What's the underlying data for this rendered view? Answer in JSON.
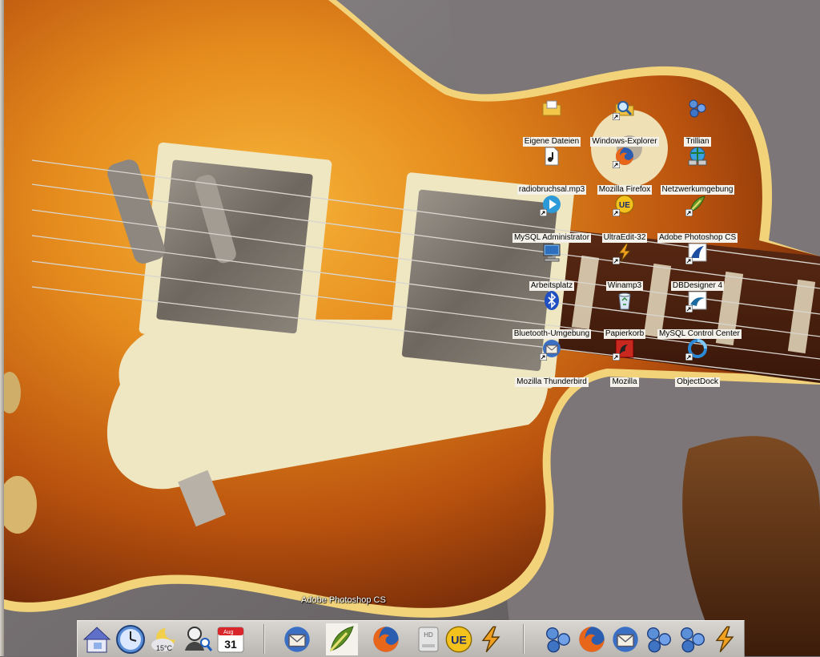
{
  "desktop": {
    "icons": [
      {
        "label": "Eigene Dateien",
        "icon": "folder-docs-icon"
      },
      {
        "label": "Windows-Explorer",
        "icon": "explorer-icon"
      },
      {
        "label": "Trillian",
        "icon": "trillian-icon"
      },
      {
        "label": "radiobruchsal.mp3",
        "icon": "mp3-file-icon"
      },
      {
        "label": "Mozilla Firefox",
        "icon": "firefox-icon"
      },
      {
        "label": "Netzwerkumgebung",
        "icon": "network-icon"
      },
      {
        "label": "MySQL Administrator",
        "icon": "mysql-admin-icon"
      },
      {
        "label": "UltraEdit-32",
        "icon": "ultraedit-icon"
      },
      {
        "label": "Adobe Photoshop CS",
        "icon": "photoshop-icon"
      },
      {
        "label": "Arbeitsplatz",
        "icon": "computer-icon"
      },
      {
        "label": "Winamp3",
        "icon": "winamp-icon"
      },
      {
        "label": "DBDesigner 4",
        "icon": "dbdesigner-icon"
      },
      {
        "label": "Bluetooth-Umgebung",
        "icon": "bluetooth-icon"
      },
      {
        "label": "Papierkorb",
        "icon": "recycle-bin-icon"
      },
      {
        "label": "MySQL Control Center",
        "icon": "mysql-cc-icon"
      },
      {
        "label": "Mozilla Thunderbird",
        "icon": "thunderbird-icon"
      },
      {
        "label": "Mozilla",
        "icon": "mozilla-icon"
      },
      {
        "label": "ObjectDock",
        "icon": "objectdock-icon"
      }
    ]
  },
  "dock": {
    "tooltip": "Adobe Photoshop CS",
    "weather_temp": "15°C",
    "calendar_month": "Aug",
    "calendar_day": "31",
    "drive_label": "HD",
    "items": [
      {
        "name": "home-icon"
      },
      {
        "name": "clock-icon"
      },
      {
        "name": "weather-icon"
      },
      {
        "name": "user-search-icon"
      },
      {
        "name": "calendar-icon"
      },
      {
        "name": "thunderbird-icon"
      },
      {
        "name": "photoshop-icon"
      },
      {
        "name": "firefox-icon"
      },
      {
        "name": "hard-drive-icon"
      },
      {
        "name": "ultraedit-icon"
      },
      {
        "name": "winamp-icon"
      },
      {
        "name": "trillian-icon"
      },
      {
        "name": "firefox-icon"
      },
      {
        "name": "thunderbird-icon"
      },
      {
        "name": "trillian-icon"
      },
      {
        "name": "trillian-icon"
      },
      {
        "name": "winamp-icon"
      }
    ]
  },
  "colors": {
    "label_bg": "#f3f1ea",
    "guitar_body": "#c96a14",
    "binding": "#f2d37a"
  }
}
